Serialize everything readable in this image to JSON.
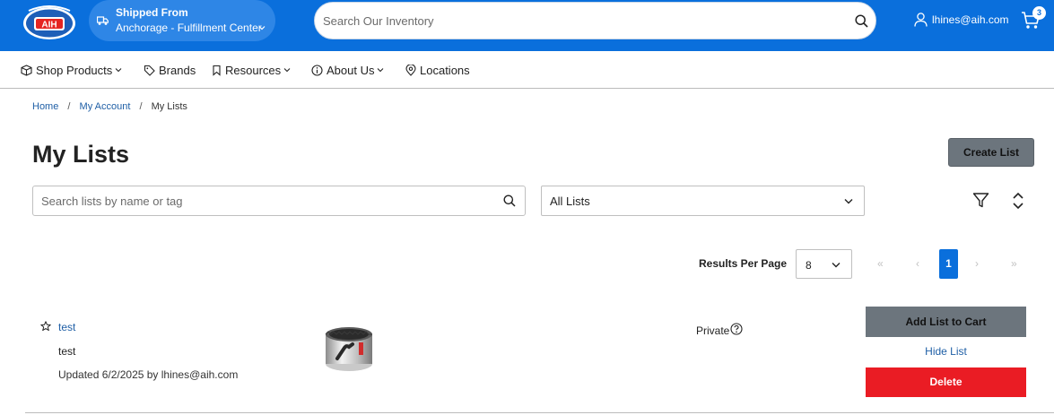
{
  "header": {
    "logo_text": "AIH",
    "ship_title": "Shipped From",
    "ship_location": "Anchorage - Fulfillment Center",
    "search_placeholder": "Search Our Inventory",
    "user_email": "lhines@aih.com",
    "cart_count": "3"
  },
  "nav": {
    "items": [
      {
        "label": "Shop Products"
      },
      {
        "label": "Brands"
      },
      {
        "label": "Resources"
      },
      {
        "label": "About Us"
      },
      {
        "label": "Locations"
      }
    ]
  },
  "breadcrumb": {
    "home": "Home",
    "account": "My Account",
    "current": "My Lists",
    "separator": "/"
  },
  "page": {
    "title": "My Lists",
    "create_label": "Create List",
    "list_search_placeholder": "Search lists by name or tag",
    "filter_selected": "All Lists"
  },
  "pagination": {
    "rpp_label": "Results Per Page",
    "rpp_value": "8",
    "first": "«",
    "prev": "‹",
    "current": "1",
    "next": "›",
    "last": "»"
  },
  "lists": [
    {
      "name": "test",
      "description": "test",
      "updated": "Updated 6/2/2025 by lhines@aih.com",
      "privacy": "Private",
      "add_to_cart": "Add List to Cart",
      "hide": "Hide List",
      "delete": "Delete"
    }
  ],
  "colors": {
    "brand_blue": "#0a6fdc",
    "link_blue": "#1f5fa6",
    "gray_button": "#6c757d",
    "danger_red": "#ea1c24"
  }
}
